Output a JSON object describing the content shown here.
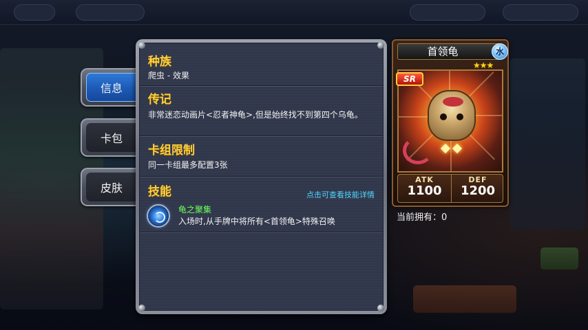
{
  "tabs": [
    {
      "label": "信息",
      "active": true
    },
    {
      "label": "卡包",
      "active": false
    },
    {
      "label": "皮肤",
      "active": false
    }
  ],
  "info": {
    "race": {
      "title": "种族",
      "text": "爬虫 - 效果"
    },
    "bio": {
      "title": "传记",
      "text": "非常迷恋动画片<忍者神龟>,但是始终找不到第四个乌龟。"
    },
    "deck_limit": {
      "title": "卡组限制",
      "text": "同一卡组最多配置3张"
    },
    "skill": {
      "title": "技能",
      "detail_link": "点击可查看技能详情",
      "name": "龟之聚集",
      "description": "入场时,从手牌中将所有<首领龟>特殊召唤"
    }
  },
  "card": {
    "name": "首领龟",
    "attribute": "水",
    "stars": "★★★",
    "rarity": "SR",
    "atk_label": "ATK",
    "atk": "1100",
    "def_label": "DEF",
    "def": "1200",
    "owned_text": "当前拥有：0"
  },
  "colors": {
    "section_title": "#ffce3a",
    "skill_name": "#6bff5a",
    "detail_link": "#4fd6ff",
    "active_tab": "#2f7ad8"
  }
}
